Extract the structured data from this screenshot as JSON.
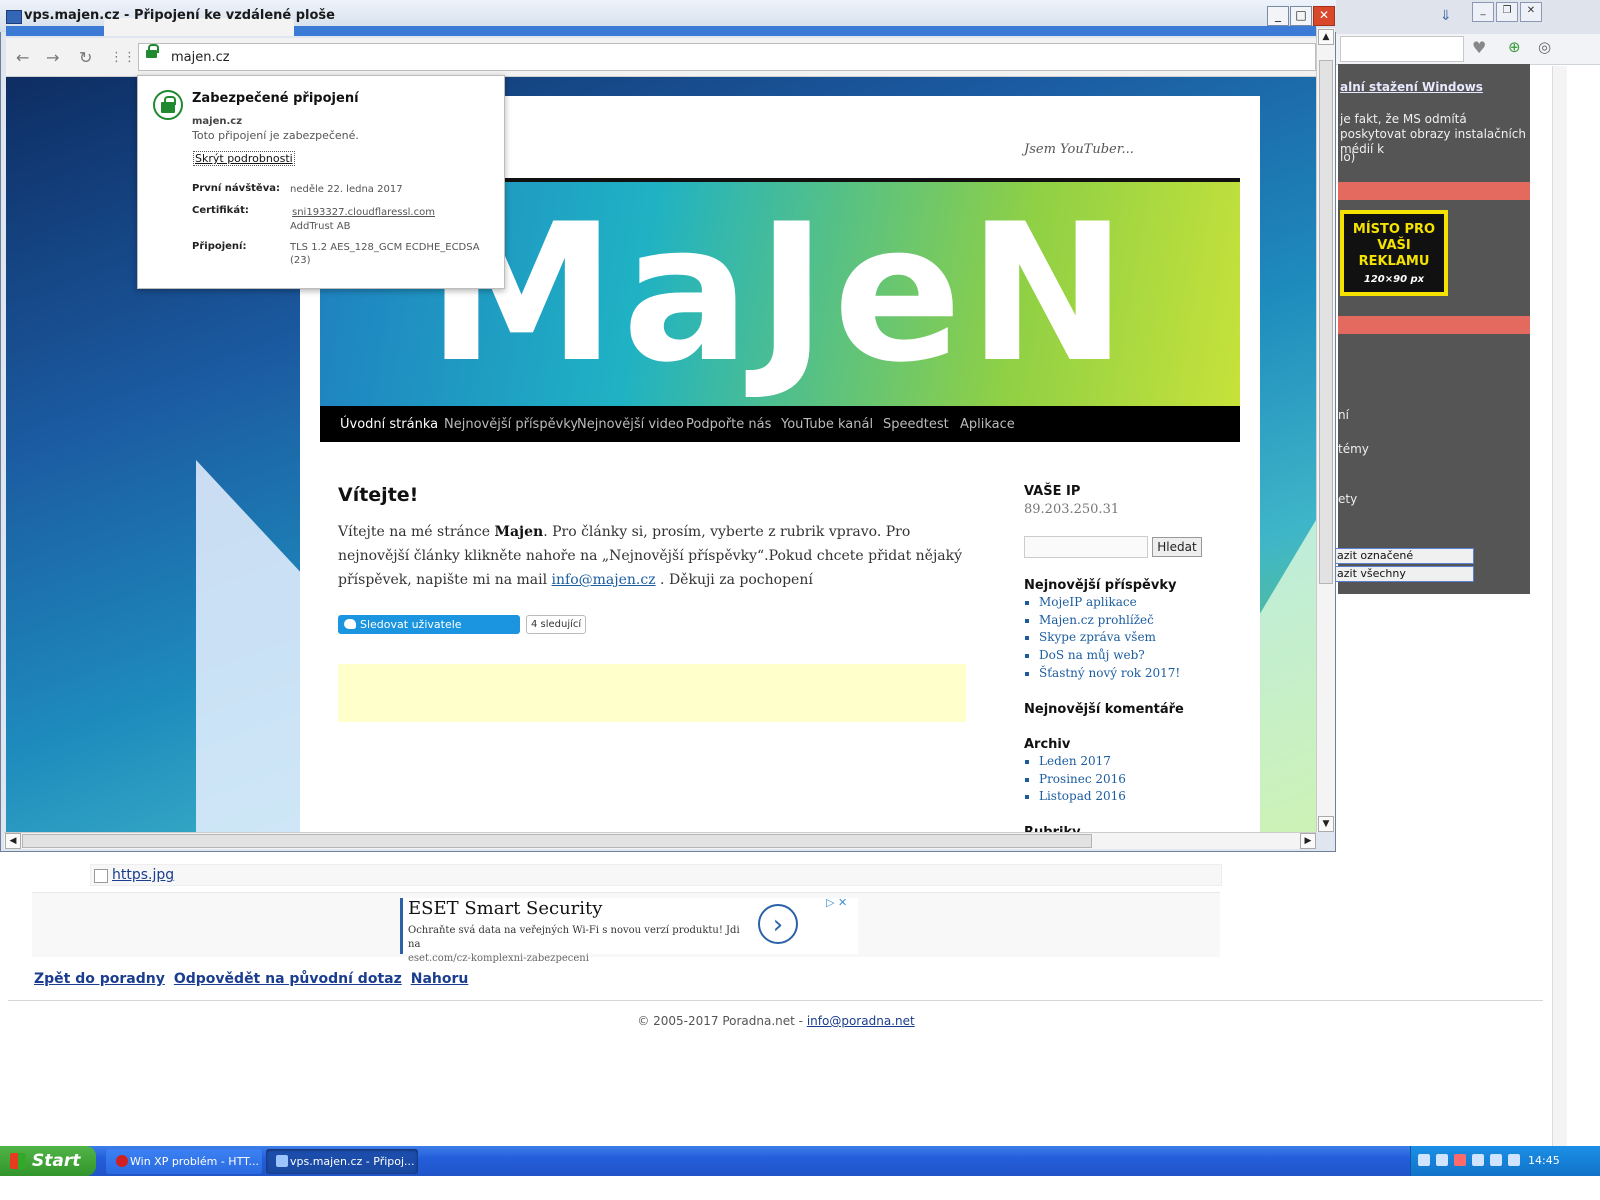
{
  "remote_window": {
    "title": "vps.majen.cz - Připojení ke vzdálené ploše",
    "buttons": {
      "minimize": "_",
      "maximize": "□",
      "close": "✕"
    }
  },
  "chrome": {
    "address": "majen.cz"
  },
  "site_info_popup": {
    "title": "Zabezpečené připojení",
    "domain": "majen.cz",
    "status": "Toto připojení je zabezpečené.",
    "hide_details": "Skrýt podrobnosti",
    "first_visit_label": "První návštěva:",
    "first_visit_value": "neděle 22. ledna 2017",
    "certificate_label": "Certifikát:",
    "certificate_value": "sni193327.cloudflaressl.com",
    "certificate_issuer": "AddTrust AB",
    "connection_label": "Připojení:",
    "connection_value": "TLS 1.2 AES_128_GCM ECDHE_ECDSA (23)"
  },
  "site": {
    "tagline": "Jsem YouTuber...",
    "logo": "MaJeN",
    "nav": [
      "Úvodní stránka",
      "Nejnovější příspěvky",
      "Nejnovější video",
      "Podpořte nás",
      "YouTube kanál",
      "Speedtest",
      "Aplikace"
    ],
    "post_title": "Vítejte!",
    "post_body_1": "Vítejte na mé stránce ",
    "post_body_bold": "Majen",
    "post_body_2": ". Pro články si, prosím, vyberte z rubrik vpravo. Pro nejnovější články klikněte nahoře na „Nejnovější příspěvky“.Pokud chcete přidat nějaký příspěvek, napište mi na mail ",
    "post_email": "info@majen.cz",
    "post_body_3": " . Děkuji za pochopení",
    "follow_button": "Sledovat uživatele @MaraJenes",
    "follow_count": "4 sledující",
    "sidebar": {
      "ip_title": "VAŠE IP",
      "ip_value": "89.203.250.31",
      "search_button": "Hledat",
      "recent_posts_title": "Nejnovější příspěvky",
      "recent_posts": [
        "MojeIP aplikace",
        "Majen.cz prohlížeč",
        "Skype zpráva všem",
        "DoS na můj web?",
        "Šťastný nový rok 2017!"
      ],
      "recent_comments_title": "Nejnovější komentáře",
      "archive_title": "Archiv",
      "archive": [
        "Leden 2017",
        "Prosinec 2016",
        "Listopad 2016"
      ],
      "categories_title": "Rubriky"
    }
  },
  "background_page": {
    "side_link": "alní stažení Windows",
    "side_text": "je fakt, že MS odmítá poskytovat obrazy instalačních médií k",
    "side_frag_1": "lo)",
    "ad_text": "MÍSTO PRO VAŠI REKLAMU",
    "ad_size": "120×90 px",
    "frag_1": "ní",
    "frag_2": "témy",
    "frag_3": "ety",
    "btn_marked": "azit označené",
    "btn_all": "azit všechny",
    "attachment": "https.jpg",
    "eset_title": "ESET Smart Security",
    "eset_desc": "Ochraňte svá data na veřejných Wi-Fi s novou verzí produktu! Jdi na",
    "eset_url": "eset.com/cz-komplexni-zabezpeceni",
    "links": [
      "Zpět do poradny",
      "Odpovědět na původní dotaz",
      "Nahoru"
    ],
    "footer_text": "© 2005-2017 Poradna.net - ",
    "footer_email": "info@poradna.net"
  },
  "taskbar": {
    "start": "Start",
    "tasks": [
      "Win XP problém - HTT...",
      "vps.majen.cz - Připoj..."
    ],
    "clock": "14:45"
  },
  "colors": {
    "accent_blue": "#1b95e0",
    "secure_green": "#1f8a2f",
    "link_blue": "#1a3d8f"
  }
}
